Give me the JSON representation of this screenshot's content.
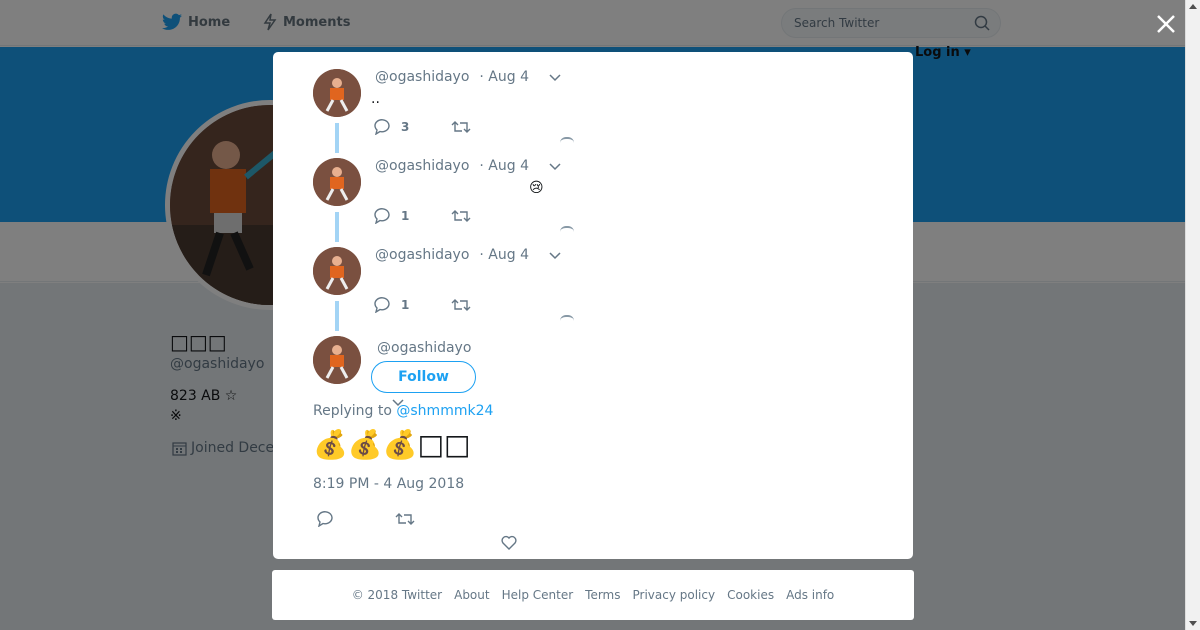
{
  "nav": {
    "home_label": "Home",
    "moments_label": "Moments",
    "search_placeholder": "Search Twitter",
    "login_label": "Log in ▾"
  },
  "profile": {
    "name": "□□□",
    "handle": "@ogashidayo",
    "bio_line1": "823 AB ☆",
    "bio_line2": "※",
    "joined": "Joined Dece"
  },
  "thread": [
    {
      "handle": "@ogashidayo",
      "date": "· Aug 4",
      "text": "..",
      "reply_count": "3"
    },
    {
      "handle": "@ogashidayo",
      "date": "· Aug 4",
      "text": "😢",
      "reply_count": "1"
    },
    {
      "handle": "@ogashidayo",
      "date": "· Aug 4",
      "text": "",
      "reply_count": "1"
    }
  ],
  "main_tweet": {
    "handle": "@ogashidayo",
    "follow_label": "Follow",
    "replying_prefix": "Replying to ",
    "replying_to": "@shmmmk24",
    "text": "💰💰💰□□",
    "timestamp": "8:19 PM - 4 Aug 2018"
  },
  "footer": {
    "copyright": "© 2018 Twitter",
    "about": "About",
    "help": "Help Center",
    "terms": "Terms",
    "privacy": "Privacy policy",
    "cookies": "Cookies",
    "ads": "Ads info"
  },
  "colors": {
    "brand": "#1da1f2",
    "thread_line": "#a3d4f5",
    "muted": "#657786"
  },
  "icons": [
    "twitter-bird-icon",
    "lightning-icon",
    "search-icon",
    "close-icon",
    "chevron-down-icon",
    "reply-icon",
    "retweet-icon",
    "like-icon",
    "calendar-icon"
  ]
}
